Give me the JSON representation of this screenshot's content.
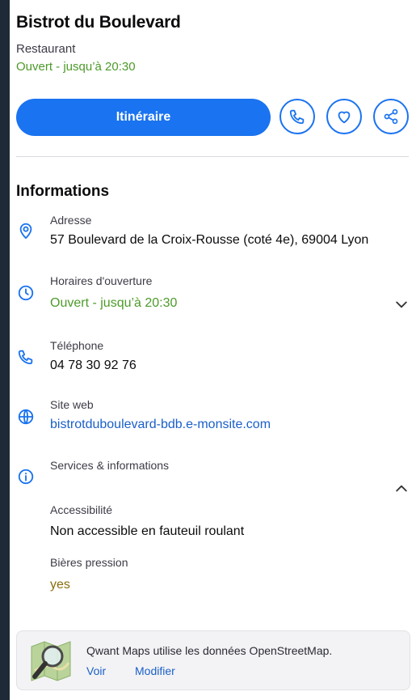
{
  "place": {
    "name": "Bistrot du Boulevard",
    "category": "Restaurant",
    "status": "Ouvert - jusqu’à 20:30"
  },
  "actions": {
    "directions_label": "Itinéraire",
    "icons": [
      "phone-icon",
      "heart-icon",
      "share-icon"
    ]
  },
  "info": {
    "title": "Informations",
    "address": {
      "label": "Adresse",
      "value": "57 Boulevard de la Croix-Rousse (coté 4e), 69004 Lyon"
    },
    "hours": {
      "label": "Horaires d'ouverture",
      "value": "Ouvert - jusqu’à 20:30"
    },
    "phone": {
      "label": "Téléphone",
      "value": "04 78 30 92 76"
    },
    "website": {
      "label": "Site web",
      "value": "bistrotduboulevard-bdb.e-monsite.com"
    },
    "services": {
      "label": "Services & informations",
      "items": [
        {
          "label": "Accessibilité",
          "value": "Non accessible en fauteuil roulant"
        },
        {
          "label": "Bières pression",
          "value": "yes"
        }
      ]
    }
  },
  "footer": {
    "text": "Qwant Maps utilise les données OpenStreetMap.",
    "view_label": "Voir",
    "edit_label": "Modifier"
  },
  "colors": {
    "accent": "#1a73f0",
    "open_status": "#4d9a2a",
    "link": "#1a5fc9",
    "background": "#1e2a38"
  }
}
